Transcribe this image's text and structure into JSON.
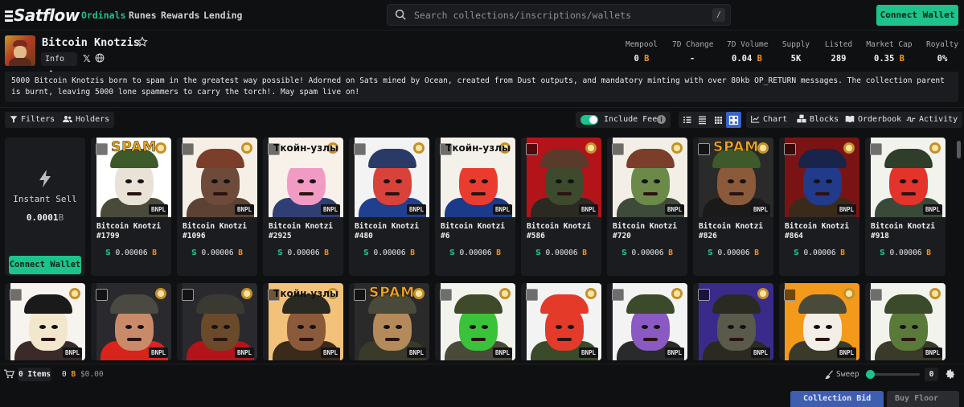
{
  "nav": {
    "logo": "Satflow",
    "items": [
      "Ordinals",
      "Runes",
      "Rewards",
      "Lending"
    ],
    "search_placeholder": "Search collections/inscriptions/wallets",
    "search_shortcut": "/",
    "connect_wallet": "Connect Wallet"
  },
  "collection": {
    "title": "Bitcoin Knotzis",
    "info_label": "Info",
    "stats": [
      {
        "label": "Mempool",
        "value": "0",
        "unit": "B"
      },
      {
        "label": "7D Change",
        "value": "-",
        "unit": ""
      },
      {
        "label": "7D Volume",
        "value": "0.04",
        "unit": "B"
      },
      {
        "label": "Supply",
        "value": "5K",
        "unit": ""
      },
      {
        "label": "Listed",
        "value": "289",
        "unit": ""
      },
      {
        "label": "Market Cap",
        "value": "0.35",
        "unit": "B"
      },
      {
        "label": "Royalty",
        "value": "0%",
        "unit": ""
      }
    ],
    "description": "5000 Bitcoin Knotzis born to spam in the greatest way possible! Adorned on Sats mined by Ocean, created from Dust outputs, and mandatory minting with over 80kb OP_RETURN messages. The collection parent is burnt, leaving 5000 lone spammers to carry the torch!. May spam live on!"
  },
  "toolbar": {
    "filters": "Filters",
    "holders": "Holders",
    "include_fees": "Include Fees",
    "include_fees_on": true,
    "chart": "Chart",
    "blocks": "Blocks",
    "orderbook": "Orderbook",
    "activity": "Activity"
  },
  "instant_sell": {
    "title": "Instant Sell",
    "value": "0.0001",
    "unit": "B",
    "button": "Connect Wallet"
  },
  "badge": "BNPL",
  "price_prefix": "S",
  "price_unit": "B",
  "items_row1": [
    {
      "name": "Bitcoin Knotzi #1799",
      "price": "0.00006",
      "bg": "#ffffff",
      "skin": "#e9e2d6",
      "cap": "#3e5a2a",
      "body": "#4a4a3a",
      "tag": "spam"
    },
    {
      "name": "Bitcoin Knotzi #1096",
      "price": "0.00006",
      "bg": "#f6efe6",
      "skin": "#6e4a3a",
      "cap": "#7a3e2a",
      "body": "#5b4233",
      "tag": ""
    },
    {
      "name": "Bitcoin Knotzi #2925",
      "price": "0.00006",
      "bg": "#f7f1e9",
      "skin": "#f19bc4",
      "cap": "#f7f1e9",
      "body": "#2f3f73",
      "tag": "ru"
    },
    {
      "name": "Bitcoin Knotzi #480",
      "price": "0.00006",
      "bg": "#f3f3f3",
      "skin": "#d9413b",
      "cap": "#2a3a66",
      "body": "#1f3f8f",
      "tag": ""
    },
    {
      "name": "Bitcoin Knotzi #6",
      "price": "0.00006",
      "bg": "#f4f1ea",
      "skin": "#ea3b2f",
      "cap": "#f4f1ea",
      "body": "#1b3a8a",
      "tag": "ru"
    },
    {
      "name": "Bitcoin Knotzi #586",
      "price": "0.00006",
      "bg": "#b3141a",
      "skin": "#3e4a2e",
      "cap": "#5a3a2a",
      "body": "#2a2a22",
      "tag": ""
    },
    {
      "name": "Bitcoin Knotzi #720",
      "price": "0.00006",
      "bg": "#f3efe6",
      "skin": "#6b8a4a",
      "cap": "#7a3e2a",
      "body": "#3e4a3a",
      "tag": ""
    },
    {
      "name": "Bitcoin Knotzi #826",
      "price": "0.00006",
      "bg": "#2a2a2a",
      "skin": "#8a5a3a",
      "cap": "#3e5a2a",
      "body": "#1a1a1a",
      "tag": "spam"
    },
    {
      "name": "Bitcoin Knotzi #864",
      "price": "0.00006",
      "bg": "#7a1414",
      "skin": "#223a8a",
      "cap": "#18244a",
      "body": "#3a2a1a",
      "tag": ""
    },
    {
      "name": "Bitcoin Knotzi #918",
      "price": "0.00006",
      "bg": "#f3f3ee",
      "skin": "#e3332a",
      "cap": "#2e3e2a",
      "body": "#3a4a3a",
      "tag": ""
    }
  ],
  "items_row2": [
    {
      "bg": "#f7f3ee",
      "skin": "#f2e6cc",
      "cap": "#1a1a1a",
      "body": "#3a2a2a",
      "tag": ""
    },
    {
      "bg": "#2a2a2e",
      "skin": "#c98a6a",
      "cap": "#4a4a42",
      "body": "#d8241a",
      "tag": ""
    },
    {
      "bg": "#2a2a2e",
      "skin": "#6a4a2a",
      "cap": "#3a3a32",
      "body": "#b3141a",
      "tag": ""
    },
    {
      "bg": "#f3c27a",
      "skin": "#8a5a3a",
      "cap": "#2a2a22",
      "body": "#3a2a1a",
      "tag": "ru"
    },
    {
      "bg": "#2a2a2a",
      "skin": "#b58a5a",
      "cap": "#4a4a3a",
      "body": "#3a3a2a",
      "tag": "spam"
    },
    {
      "bg": "#f3f3ee",
      "skin": "#3ac23a",
      "cap": "#3e4a2a",
      "body": "#4a4a3a",
      "tag": ""
    },
    {
      "bg": "#f3f3f3",
      "skin": "#e33a2a",
      "cap": "#e33a2a",
      "body": "#3a4a2a",
      "tag": ""
    },
    {
      "bg": "#f3f3f3",
      "skin": "#8a5ac2",
      "cap": "#3a4a2a",
      "body": "#2a2a2a",
      "tag": ""
    },
    {
      "bg": "#3a2a8a",
      "skin": "#5a5a4a",
      "cap": "#2a2a22",
      "body": "#2a2a22",
      "tag": ""
    },
    {
      "bg": "#f39a1a",
      "skin": "#f3efe6",
      "cap": "#4a4a3a",
      "body": "#3a3a2a",
      "tag": ""
    },
    {
      "bg": "#f3f3ee",
      "skin": "#5a7a3a",
      "cap": "#3a4a2a",
      "body": "#3a3a2a",
      "tag": ""
    }
  ],
  "footer": {
    "items_count": "0 Items",
    "total_btc": "0",
    "total_unit": "B",
    "total_usd": "$0.00",
    "sweep": "Sweep",
    "sweep_value": "0",
    "collection_bid": "Collection Bid",
    "buy_floor": "Buy Floor"
  },
  "colors": {
    "accent": "#1ec28b",
    "btc": "#f7931a",
    "view_active": "#3a63c9"
  }
}
